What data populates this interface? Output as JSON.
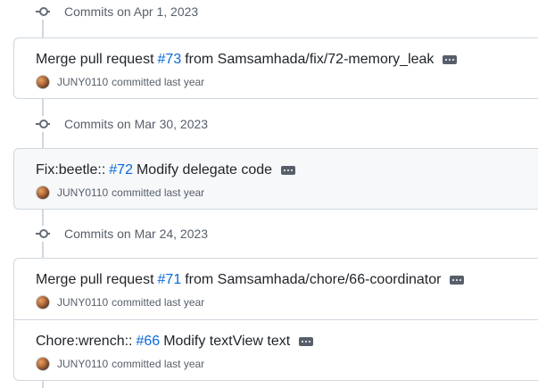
{
  "groups": [
    {
      "header": "Commits on Apr 1, 2023",
      "commits": [
        {
          "title_prefix": "Merge pull request",
          "pr": "#73",
          "title_suffix": "from Samsamhada/fix/72-memory_leak",
          "author": "JUNY0110",
          "meta": "committed last year"
        }
      ]
    },
    {
      "header": "Commits on Mar 30, 2023",
      "commits": [
        {
          "title_prefix": "Fix:beetle::",
          "pr": "#72",
          "title_suffix": "Modify delegate code",
          "author": "JUNY0110",
          "meta": "committed last year"
        }
      ]
    },
    {
      "header": "Commits on Mar 24, 2023",
      "commits": [
        {
          "title_prefix": "Merge pull request",
          "pr": "#71",
          "title_suffix": "from Samsamhada/chore/66-coordinator",
          "author": "JUNY0110",
          "meta": "committed last year"
        },
        {
          "title_prefix": "Chore:wrench::",
          "pr": "#66",
          "title_suffix": "Modify textView text",
          "author": "JUNY0110",
          "meta": "committed last year"
        }
      ]
    }
  ]
}
